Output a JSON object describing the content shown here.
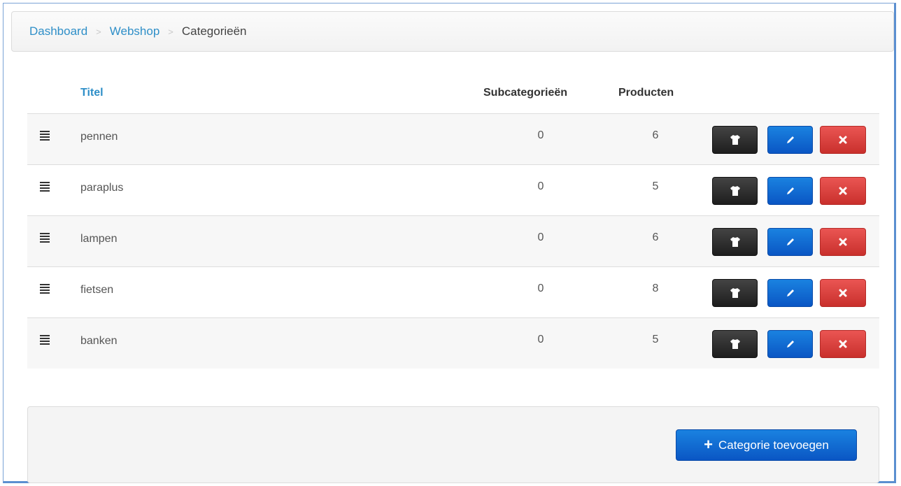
{
  "breadcrumb": {
    "items": [
      {
        "label": "Dashboard",
        "type": "link"
      },
      {
        "label": "Webshop",
        "type": "link"
      },
      {
        "label": "Categorieën",
        "type": "current"
      }
    ],
    "separator": ">"
  },
  "table": {
    "headers": {
      "title": "Titel",
      "subcategories": "Subcategorieën",
      "products": "Producten"
    },
    "rows": [
      {
        "title": "pennen",
        "subcategories": "0",
        "products": "6"
      },
      {
        "title": "paraplus",
        "subcategories": "0",
        "products": "5"
      },
      {
        "title": "lampen",
        "subcategories": "0",
        "products": "6"
      },
      {
        "title": "fietsen",
        "subcategories": "0",
        "products": "8"
      },
      {
        "title": "banken",
        "subcategories": "0",
        "products": "5"
      }
    ],
    "row_actions": [
      {
        "icon": "tshirt-icon",
        "color": "#222222"
      },
      {
        "icon": "pencil-icon",
        "color": "#0e6bd6"
      },
      {
        "icon": "close-icon",
        "color": "#d9423f"
      }
    ]
  },
  "footer": {
    "add_button_label": "Categorie toevoegen",
    "add_button_icon": "plus-icon"
  },
  "colors": {
    "link": "#2f8fc8",
    "primary": "#0e6bd6",
    "danger": "#d9423f",
    "dark": "#222222"
  }
}
